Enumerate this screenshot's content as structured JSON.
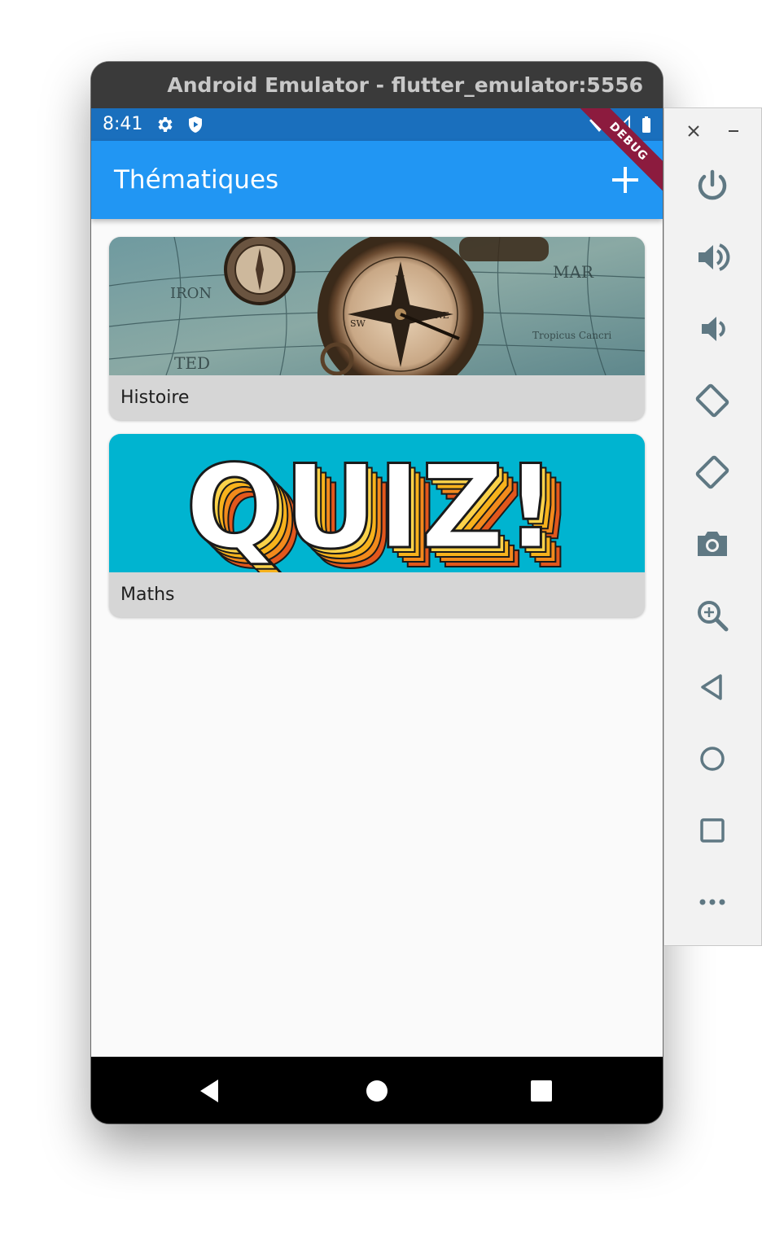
{
  "emulator": {
    "title": "Android Emulator - flutter_emulator:5556"
  },
  "status_bar": {
    "time": "8:41"
  },
  "app_bar": {
    "title": "Thématiques",
    "debug_label": "DEBUG"
  },
  "cards": [
    {
      "label": "Histoire",
      "image": "compass-on-map-image"
    },
    {
      "label": "Maths",
      "image": "quiz-banner-image",
      "image_text": "QUIZ!"
    }
  ],
  "colors": {
    "status_bar": "#1a6fbd",
    "app_bar": "#2196f3",
    "card_background": "#d6d6d6",
    "quiz_background": "#00b4d0",
    "debug_banner": "#8c1b3e"
  },
  "side_toolbar": {
    "window_controls": [
      "close-icon",
      "minimize-icon"
    ],
    "buttons": [
      "power-icon",
      "volume-up-icon",
      "volume-down-icon",
      "rotate-left-icon",
      "rotate-right-icon",
      "camera-icon",
      "zoom-icon",
      "back-icon",
      "home-icon",
      "overview-icon",
      "more-icon"
    ]
  }
}
